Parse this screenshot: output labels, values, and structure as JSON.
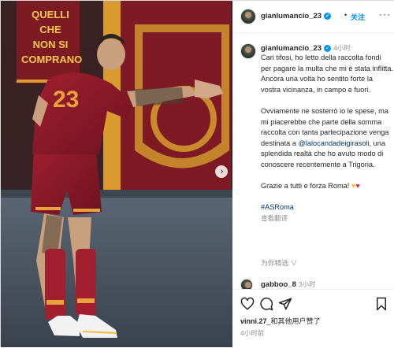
{
  "post": {
    "username": "gianlumancio_23",
    "follow_label": "关注",
    "more_label": "···",
    "verified_mark": "✓"
  },
  "photo": {
    "banner_lines": [
      "QUELLI CHE",
      "NON SI",
      "COMPRANO"
    ],
    "jersey_number": "23",
    "carousel_next": "›"
  },
  "caption": {
    "username": "gianlumancio_23",
    "time": "4小时",
    "para1": "Cari tifosi, ho letto della raccolta fondi per pagare la multa che mi è stata inflitta. Ancora una volta ho sentito forte la vostra vicinanza, in campo e fuori.",
    "para2_before": "Ovviamente ne sosterrò io le spese, ma mi piacerebbe che parte della somma raccolta con tanta partecipazione venga destinata a ",
    "para2_mention": "@lalocandadeigirasoli",
    "para2_after": ", una splendida realtà che ho avuto modo di conoscere recentemente a Trigoria.",
    "para3": "Grazie a tutti e forza Roma!",
    "heart_yellow": "♥",
    "heart_red": "♥",
    "hashtag": "#ASRoma",
    "see_translation": "查看翻译",
    "for_you": "为你精选 ∨"
  },
  "comment": {
    "username": "gabboo_8",
    "time": "3小时"
  },
  "actions": {
    "likes_user": "vinni.27",
    "likes_rest": "_和其他用户赞了",
    "posted_time": "4小时前"
  },
  "colors": {
    "link_blue": "#0095f6",
    "mention_blue": "#00376b",
    "roma_red": "#8b1a2b",
    "roma_gold": "#e8a33a"
  }
}
